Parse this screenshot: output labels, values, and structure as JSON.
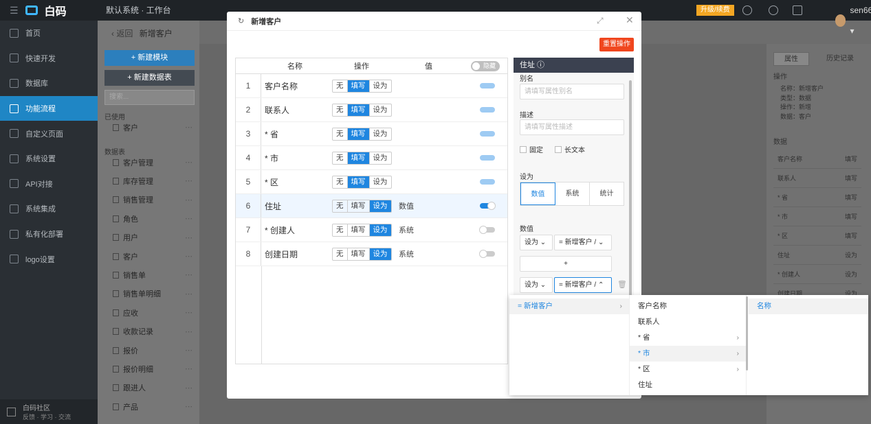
{
  "topbar": {
    "logo_text": "白码",
    "system_name": "默认系统 · 工作台",
    "upgrade_label": "升级/续费",
    "user_name": "sen666 ▾"
  },
  "sidebar": {
    "items": [
      {
        "label": "首页",
        "icon": "home-icon"
      },
      {
        "label": "快速开发",
        "icon": "rocket-icon"
      },
      {
        "label": "数据库",
        "icon": "database-icon"
      },
      {
        "label": "功能流程",
        "icon": "flow-icon",
        "active": true
      },
      {
        "label": "自定义页面",
        "icon": "page-icon"
      },
      {
        "label": "系统设置",
        "icon": "settings-icon"
      },
      {
        "label": "API对接",
        "icon": "api-icon"
      },
      {
        "label": "系统集成",
        "icon": "integration-icon"
      },
      {
        "label": "私有化部署",
        "icon": "deploy-icon"
      },
      {
        "label": "logo设置",
        "icon": "logo-icon"
      }
    ],
    "community_title": "白码社区",
    "community_sub": "反馈 · 学习 · 交流"
  },
  "secondary": {
    "breadcrumb_back": "‹ 返回",
    "breadcrumb_title": "新增客户",
    "new_module": "+ 新建模块",
    "new_table": "+ 新建数据表",
    "search_placeholder": "搜索...",
    "used_label": "已使用",
    "tables_label": "数据表",
    "used_items": [
      "客户"
    ],
    "table_items": [
      "客户管理",
      "库存管理",
      "销售管理",
      "角色",
      "用户",
      "客户",
      "销售单",
      "销售单明细",
      "应收",
      "收款记录",
      "报价",
      "报价明细",
      "跟进人",
      "产品"
    ]
  },
  "right_panel": {
    "tab_props": "属性",
    "tab_history": "历史记录",
    "op_label": "操作",
    "op_lines": [
      "名称：新增客户",
      "类型：数据",
      "操作：新增",
      "数据：客户"
    ],
    "data_label": "数据",
    "rows": [
      {
        "k": "客户名称",
        "v": "填写"
      },
      {
        "k": "联系人",
        "v": "填写"
      },
      {
        "k": "* 省",
        "v": "填写"
      },
      {
        "k": "* 市",
        "v": "填写"
      },
      {
        "k": "* 区",
        "v": "填写"
      },
      {
        "k": "住址",
        "v": "设为"
      },
      {
        "k": "* 创建人",
        "v": "设为"
      },
      {
        "k": "创建日期",
        "v": "设为"
      }
    ]
  },
  "modal": {
    "title": "新增客户",
    "reset_label": "重置操作",
    "table": {
      "headers": {
        "name": "名称",
        "op": "操作",
        "value": "值"
      },
      "hide_label": "隐藏",
      "op_options": [
        "无",
        "填写",
        "设为"
      ],
      "rows": [
        {
          "no": "1",
          "name": "客户名称",
          "op": 1,
          "val": "",
          "sw": "light"
        },
        {
          "no": "2",
          "name": "联系人",
          "op": 1,
          "val": "",
          "sw": "light"
        },
        {
          "no": "3",
          "name": "* 省",
          "op": 1,
          "val": "",
          "sw": "light"
        },
        {
          "no": "4",
          "name": "* 市",
          "op": 1,
          "val": "",
          "sw": "light"
        },
        {
          "no": "5",
          "name": "* 区",
          "op": 1,
          "val": "",
          "sw": "light"
        },
        {
          "no": "6",
          "name": "住址",
          "op": 2,
          "val": "数值",
          "sw": "on",
          "selected": true
        },
        {
          "no": "7",
          "name": "* 创建人",
          "op": 2,
          "val": "系统",
          "sw": "off"
        },
        {
          "no": "8",
          "name": "创建日期",
          "op": 2,
          "val": "系统",
          "sw": "off"
        }
      ]
    },
    "props": {
      "title": "住址 ⓘ",
      "alias_label": "别名",
      "alias_placeholder": "请填写属性别名",
      "desc_label": "描述",
      "desc_placeholder": "请填写属性描述",
      "fixed_label": "固定",
      "longtext_label": "长文本",
      "setas_label": "设为",
      "setas_options": [
        "数值",
        "系统",
        "统计"
      ],
      "setas_selected": 0,
      "value_label": "数值",
      "sel1_a": "设为  ⌄",
      "sel1_b": "= 新增客户 / ⌄",
      "add_label": "+",
      "sel2_a": "设为  ⌄",
      "sel2_b": "= 新增客户 / ⌃"
    },
    "cascade": {
      "col1": [
        {
          "label": "= 新增客户",
          "arrow": "›",
          "hl": true
        }
      ],
      "col2": [
        {
          "label": "客户名称",
          "arrow": ""
        },
        {
          "label": "联系人",
          "arrow": ""
        },
        {
          "label": "* 省",
          "arrow": "›"
        },
        {
          "label": "* 市",
          "arrow": "›",
          "hl": true
        },
        {
          "label": "* 区",
          "arrow": "›"
        },
        {
          "label": "住址",
          "arrow": ""
        }
      ],
      "col3": [
        {
          "label": "名称",
          "arrow": "",
          "hl": true
        }
      ]
    }
  }
}
